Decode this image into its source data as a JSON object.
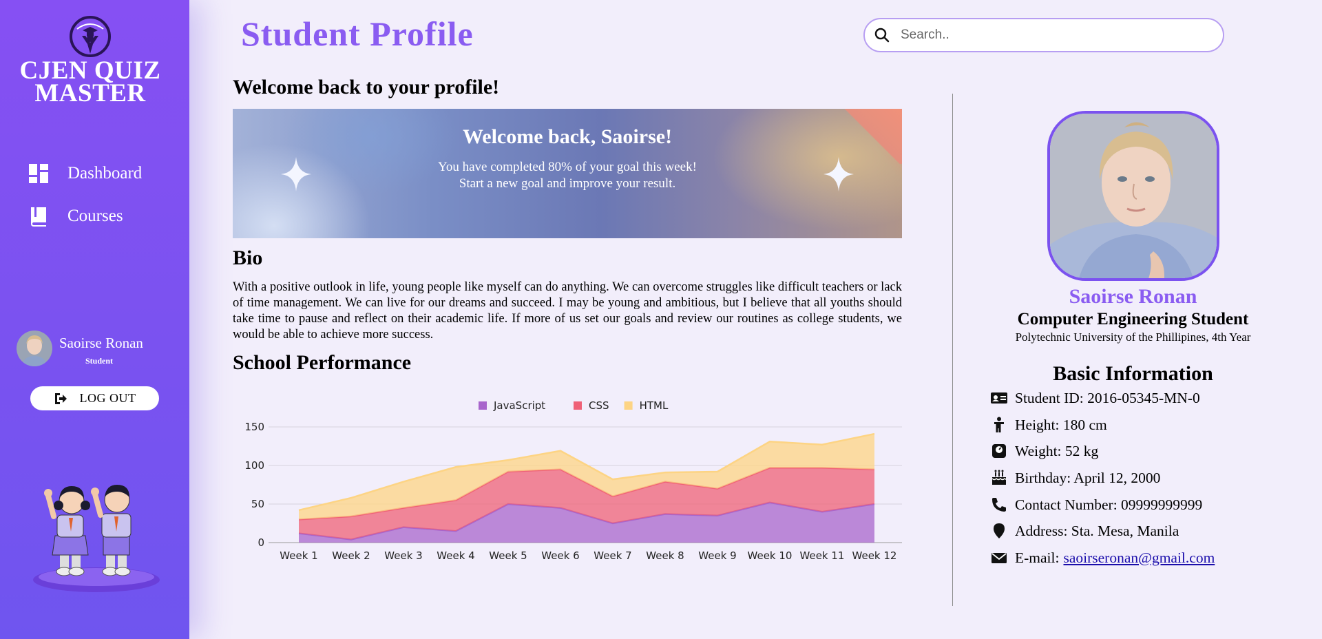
{
  "brand": {
    "name": "CJEN QUIZ MASTER"
  },
  "sidebar": {
    "items": [
      {
        "label": "Dashboard",
        "icon": "dashboard-icon"
      },
      {
        "label": "Courses",
        "icon": "book-icon"
      }
    ],
    "user": {
      "name": "Saoirse Ronan",
      "role": "Student"
    },
    "logout_label": "LOG OUT"
  },
  "header": {
    "title": "Student Profile",
    "search": {
      "placeholder": "Search..",
      "value": ""
    }
  },
  "main": {
    "welcome_heading": "Welcome back to your profile!",
    "banner": {
      "title": "Welcome back, Saoirse!",
      "line1": "You have completed 80% of your goal this week!",
      "line2": "Start a new goal and improve your result."
    },
    "bio_heading": "Bio",
    "bio_text": "With a positive outlook in life, young people like myself can do anything. We can overcome struggles like difficult teachers or lack of time management. We can live for our dreams and succeed. I may be young and ambitious, but I believe that all youths should take time to pause and reflect on their academic life. If more of us set our goals and review our routines as college students, we would be able to achieve more success.",
    "performance_heading": "School Performance"
  },
  "chart_data": {
    "type": "area",
    "stacked": true,
    "categories": [
      "Week 1",
      "Week 2",
      "Week 3",
      "Week 4",
      "Week 5",
      "Week 6",
      "Week 7",
      "Week 8",
      "Week 9",
      "Week 10",
      "Week 11",
      "Week 12"
    ],
    "series": [
      {
        "name": "JavaScript",
        "color": "#a865cc",
        "values": [
          12,
          4,
          20,
          15,
          50,
          45,
          25,
          37,
          35,
          52,
          40,
          50
        ]
      },
      {
        "name": "CSS",
        "color": "#ef6177",
        "values": [
          18,
          30,
          25,
          40,
          42,
          50,
          35,
          42,
          35,
          45,
          57,
          45
        ]
      },
      {
        "name": "HTML",
        "color": "#fdd484",
        "values": [
          12,
          24,
          34,
          43,
          15,
          24,
          22,
          12,
          22,
          34,
          30,
          46
        ]
      }
    ],
    "yticks": [
      0,
      50,
      100,
      150
    ],
    "ylim": [
      0,
      150
    ],
    "legend_position": "top",
    "grid": true
  },
  "profile": {
    "name": "Saoirse Ronan",
    "title": "Computer Engineering Student",
    "school": "Polytechnic University of the Phillipines, 4th Year",
    "info_heading": "Basic Information",
    "student_id": "Student ID: 2016-05345-MN-0",
    "height": "Height: 180 cm",
    "weight": "Weight: 52 kg",
    "birthday": "Birthday: April 12, 2000",
    "contact": "Contact Number: 09999999999",
    "address": "Address: Sta. Mesa, Manila",
    "email_label": "E-mail:",
    "email": "saoirseronan@gmail.com"
  }
}
